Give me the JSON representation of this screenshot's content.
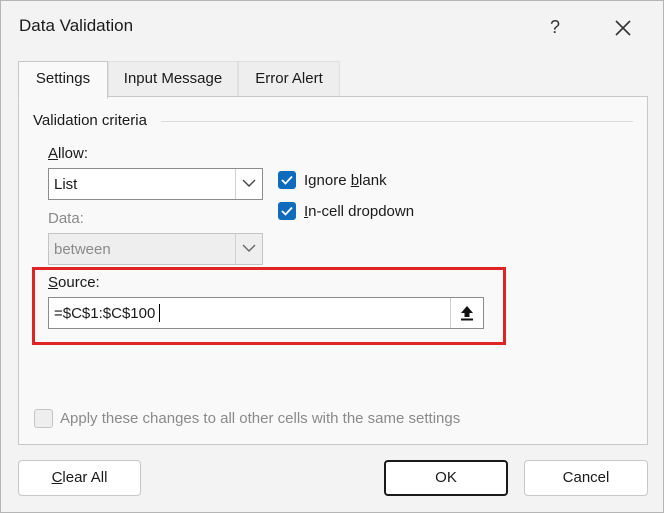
{
  "window": {
    "title": "Data Validation",
    "help": "?",
    "close": "✕"
  },
  "tabs": [
    {
      "label": "Settings",
      "active": true
    },
    {
      "label": "Input Message",
      "active": false
    },
    {
      "label": "Error Alert",
      "active": false
    }
  ],
  "settings": {
    "group_title": "Validation criteria",
    "allow": {
      "label_accel": "A",
      "label_rest": "llow:",
      "value": "List"
    },
    "data": {
      "label": "Data:",
      "value": "between"
    },
    "ignore_blank": {
      "pre": "Ignore ",
      "accel": "b",
      "post": "lank",
      "checked": true
    },
    "in_cell_dropdown": {
      "accel": "I",
      "post": "n-cell dropdown",
      "checked": true
    },
    "source": {
      "label_accel": "S",
      "label_rest": "ource:",
      "value": "=$C$1:$C$100"
    },
    "apply_all": {
      "label": "Apply these changes to all other cells with the same settings",
      "checked": false
    }
  },
  "buttons": {
    "clear_all_accel": "C",
    "clear_all_rest": "lear All",
    "ok": "OK",
    "cancel": "Cancel"
  },
  "colors": {
    "accent": "#0f6cbd",
    "highlight": "#e02424"
  }
}
